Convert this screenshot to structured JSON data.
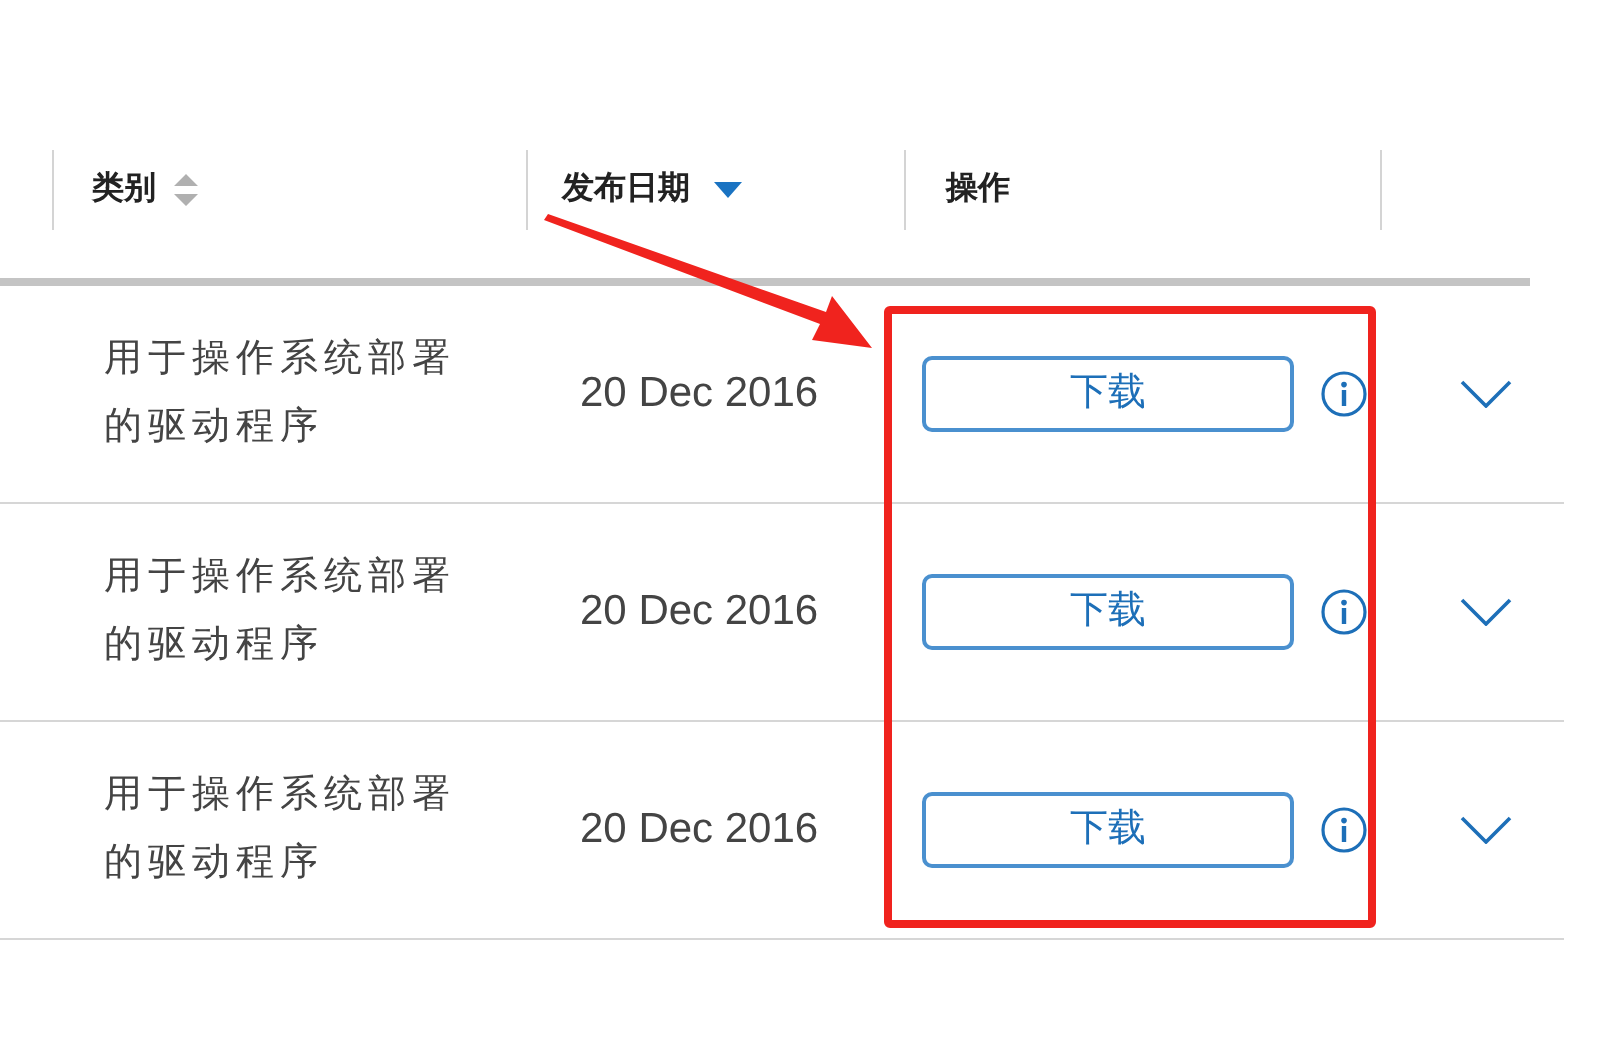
{
  "table": {
    "columns": [
      {
        "label": "类别",
        "sortable": true,
        "sorted": false
      },
      {
        "label": "发布日期",
        "sortable": true,
        "sorted": true
      },
      {
        "label": "操作",
        "sortable": false
      }
    ],
    "rows": [
      {
        "category": "用于操作系统部署的驱动程序",
        "date": "20 Dec 2016",
        "action": "下载",
        "expanded": false
      },
      {
        "category": "用于操作系统部署的驱动程序",
        "date": "20 Dec 2016",
        "action": "下载",
        "expanded": false
      },
      {
        "category": "用于操作系统部署的驱动程序",
        "date": "20 Dec 2016",
        "action": "下载",
        "expanded": false
      }
    ]
  }
}
